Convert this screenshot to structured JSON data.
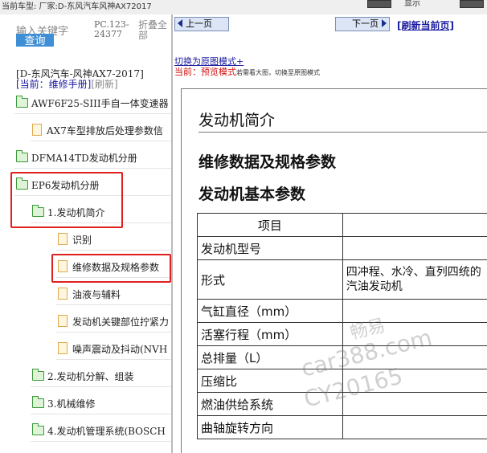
{
  "topbar": {
    "car": "当前车型:  厂家:D-东风汽车风神AX72017",
    "right_text": "显示"
  },
  "search": {
    "keyword_label": "输入关键字",
    "button": "查询",
    "pc_code": "PC.123-24377",
    "fold": "折叠全部"
  },
  "model": "[D-东风汽车-风神AX7-2017]",
  "current": {
    "label": "[当前：维修手册]",
    "refresh": "[刷新]"
  },
  "tree": [
    {
      "label": "AWF6F25-SIII手自一体变速器",
      "icon": "folder-icon"
    },
    {
      "label": "AX7车型排放后处理参数信",
      "icon": "document-icon"
    },
    {
      "label": "DFMA14TD发动机分册",
      "icon": "folder-icon"
    },
    {
      "label": "EP6发动机分册",
      "icon": "folder-icon"
    },
    {
      "label": "1.发动机简介",
      "icon": "folder-icon"
    },
    {
      "label": "识别",
      "icon": "document-icon"
    },
    {
      "label": "维修数据及规格参数",
      "icon": "document-icon"
    },
    {
      "label": "油液与辅料",
      "icon": "document-icon"
    },
    {
      "label": "发动机关键部位拧紧力",
      "icon": "document-icon"
    },
    {
      "label": "噪声震动及抖动(NVH",
      "icon": "document-icon"
    },
    {
      "label": "2.发动机分解、组装",
      "icon": "folder-icon"
    },
    {
      "label": "3.机械维修",
      "icon": "folder-icon"
    },
    {
      "label": "4.发动机管理系统(BOSCH",
      "icon": "folder-icon"
    }
  ],
  "nav": {
    "prev": "上一页",
    "next": "下一页",
    "refresh": "[刷新当前页]",
    "switch": "切换为原图模式+",
    "preview_label": "当前：",
    "preview_mode": "预览模式",
    "preview_hint": "若需看大图，切换至原图模式"
  },
  "doc": {
    "intro": "发动机简介",
    "h_data": "维修数据及规格参数",
    "h_basic": "发动机基本参数",
    "table_header": "项目",
    "rows": [
      {
        "item": "发动机型号",
        "value": ""
      },
      {
        "item": "形式",
        "value": "四冲程、水冷、直列四统的汽油发动机"
      },
      {
        "item": "气缸直径（mm）",
        "value": ""
      },
      {
        "item": "活塞行程（mm）",
        "value": ""
      },
      {
        "item": "总排量（L）",
        "value": ""
      },
      {
        "item": "压缩比",
        "value": ""
      },
      {
        "item": "燃油供给系统",
        "value": ""
      },
      {
        "item": "曲轴旋转方向",
        "value": ""
      }
    ]
  },
  "watermark": {
    "line1": "畅易",
    "line2": "car388.com",
    "line3": "CY20165"
  },
  "colors": {
    "highlight": "#e02020",
    "link": "#1a1aa0",
    "button": "#3f8fd6"
  }
}
